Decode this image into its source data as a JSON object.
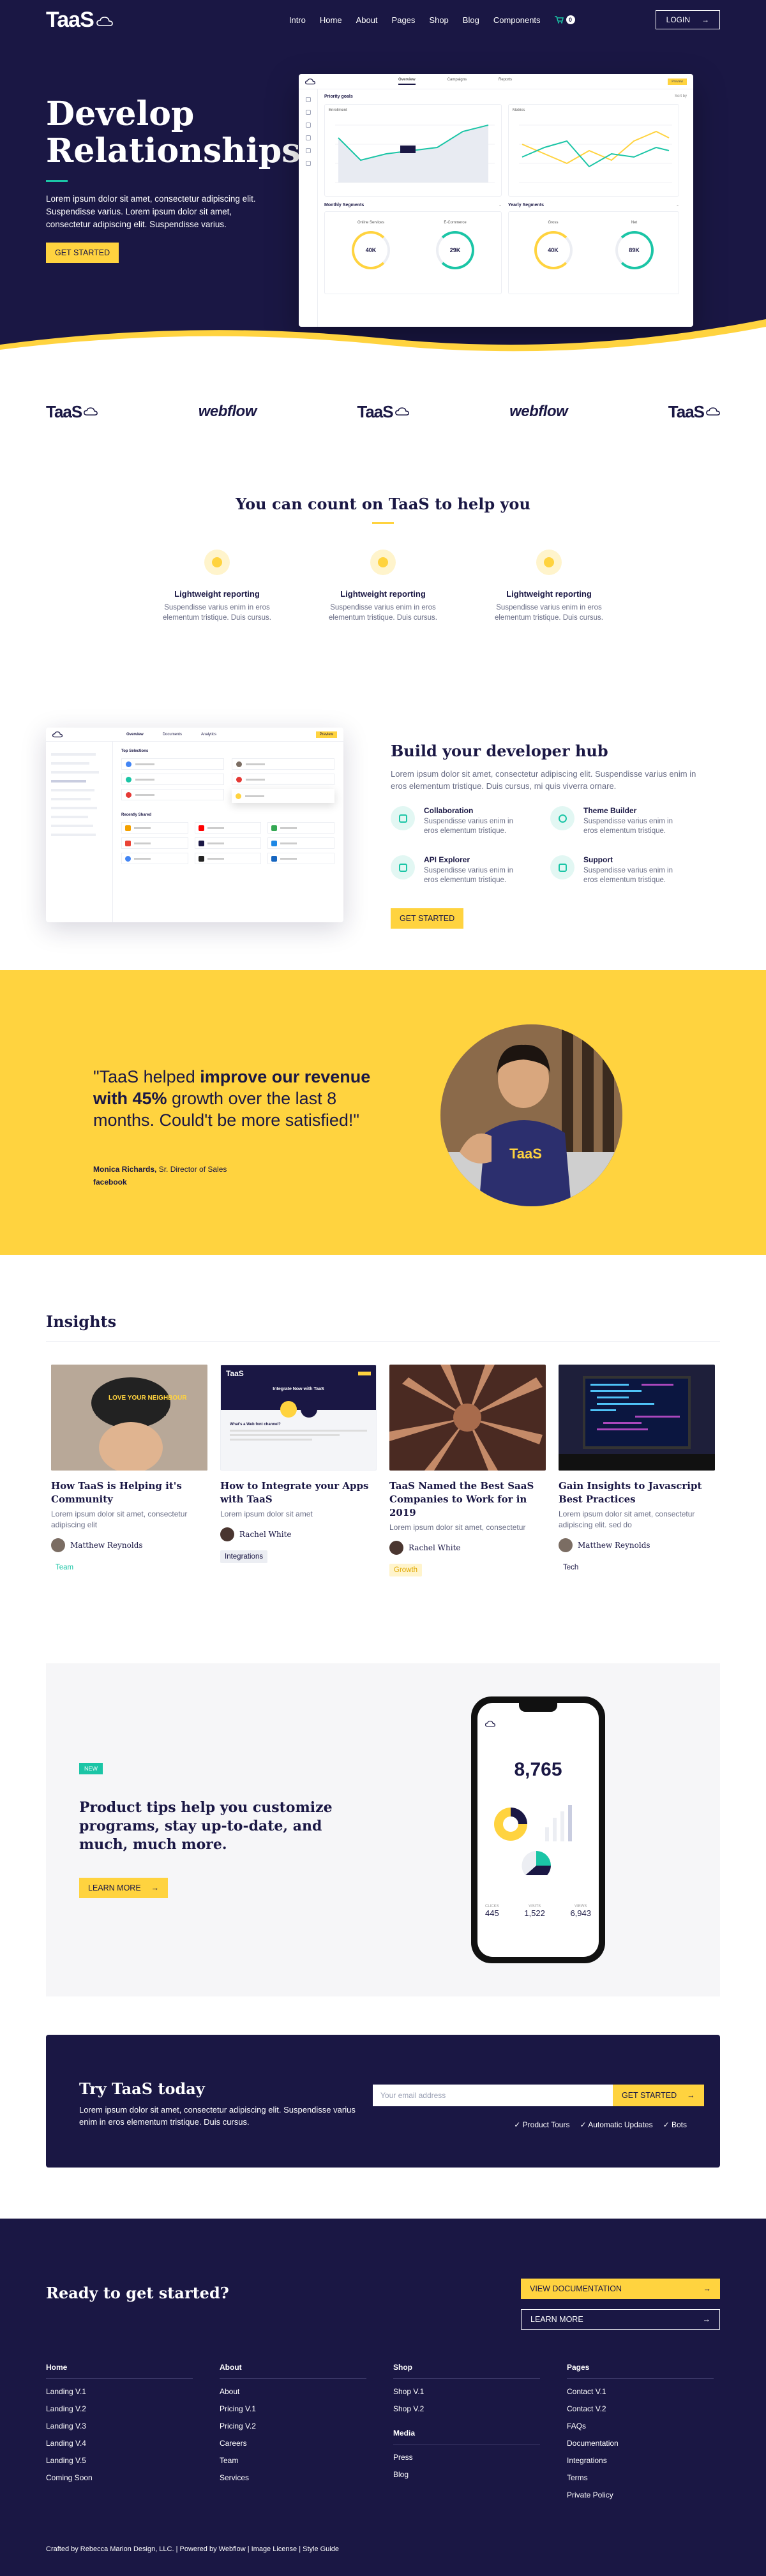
{
  "brand": "TaaS",
  "nav": {
    "links": [
      "Intro",
      "Home",
      "About",
      "Pages",
      "Shop",
      "Blog",
      "Components"
    ],
    "cart_count": "0",
    "login": "LOGIN"
  },
  "hero": {
    "title_line1": "Develop",
    "title_line2": "Relationships",
    "text": "Lorem ipsum dolor sit amet, consectetur adipiscing elit. Suspendisse varius. Lorem ipsum dolor sit amet, consectetur adipiscing elit. Suspendisse varius.",
    "cta": "GET STARTED",
    "dashboard": {
      "tabs": [
        "Overview",
        "Campaigns",
        "Reports"
      ],
      "badge": "Preview",
      "priority": "Priority goals",
      "priority_sub": "Sort by",
      "chart1_title": "Enrollment",
      "chart2_title": "Metrics",
      "monthly": "Monthly Segments",
      "yearly": "Yearly Segments",
      "m1": "Online Services",
      "m2": "E-Commerce",
      "y1": "Gross",
      "y2": "Net",
      "g1": "40K",
      "g2": "29K",
      "g3": "40K",
      "g4": "89K"
    }
  },
  "logos": [
    "TaaS",
    "webflow",
    "TaaS",
    "webflow",
    "TaaS"
  ],
  "count": {
    "title": "You can count on TaaS to help you",
    "features": [
      {
        "title": "Lightweight reporting",
        "text": "Suspendisse varius enim in eros elementum tristique. Duis cursus."
      },
      {
        "title": "Lightweight reporting",
        "text": "Suspendisse varius enim in eros elementum tristique. Duis cursus."
      },
      {
        "title": "Lightweight reporting",
        "text": "Suspendisse varius enim in eros elementum tristique. Duis cursus."
      }
    ]
  },
  "dev": {
    "title": "Build your developer hub",
    "text": "Lorem ipsum dolor sit amet, consectetur adipiscing elit. Suspendisse varius enim in eros elementum tristique. Duis cursus, mi quis viverra ornare.",
    "items": [
      {
        "title": "Collaboration",
        "text": "Suspendisse varius enim in eros elementum tristique."
      },
      {
        "title": "Theme Builder",
        "text": "Suspendisse varius enim in eros elementum tristique."
      },
      {
        "title": "API Explorer",
        "text": "Suspendisse varius enim in eros elementum tristique."
      },
      {
        "title": "Support",
        "text": "Suspendisse varius enim in eros elementum tristique."
      }
    ],
    "cta": "GET STARTED",
    "shot": {
      "tab1": "Overview",
      "tab2": "Documents",
      "tab3": "Analytics",
      "badge": "Preview",
      "top": "Top Selections",
      "recent": "Recently Shared"
    }
  },
  "testimonial": {
    "q1": "\"TaaS helped ",
    "q2": "improve our revenue with 45%",
    "q3": " growth over the last 8 months. Could't be more satisfied!\"",
    "name": "Monica Richards,",
    "role": " Sr. Director of Sales",
    "company": "facebook",
    "shirt": "TaaS"
  },
  "insights": {
    "title": "Insights",
    "cards": [
      {
        "title": "How TaaS is Helping it's Community",
        "text": "Lorem ipsum dolor sit amet, consectetur adipiscing elit",
        "author": "Matthew Reynolds",
        "tag": "Team",
        "tag_color": "#1bc5a6",
        "tag_bg": "#ffffff",
        "cap_text": "LOVE YOUR NEIGHBOUR"
      },
      {
        "title": "How to Integrate your Apps with TaaS",
        "text": "Lorem ipsum dolor sit amet",
        "author": "Rachel White",
        "tag": "Integrations",
        "tag_color": "#1a1744",
        "tag_bg": "#eceef3"
      },
      {
        "title": "TaaS Named the Best SaaS Companies to Work for in 2019",
        "text": "Lorem ipsum dolor sit amet, consectetur",
        "author": "Rachel White",
        "tag": "Growth",
        "tag_color": "#e0a800",
        "tag_bg": "#fff4cc"
      },
      {
        "title": "Gain Insights to Javascript Best Practices",
        "text": "Lorem ipsum dolor sit amet, consectetur adipiscing elit. sed do",
        "author": "Matthew Reynolds",
        "tag": "Tech",
        "tag_color": "#1a1744",
        "tag_bg": "#ffffff"
      }
    ],
    "mini": {
      "brand": "TaaS",
      "title": "Integrate Now with TaaS",
      "heading": "What's a Web font channel?"
    }
  },
  "tips": {
    "badge": "NEW",
    "title": "Product tips help you customize programs, stay up-to-date, and much, much more.",
    "cta": "LEARN MORE",
    "phone": {
      "big": "8,765",
      "s1": "445",
      "s2": "1,522",
      "s3": "6,943",
      "l1": "CLICKS",
      "l2": "VISITS",
      "l3": "VIEWS"
    }
  },
  "try": {
    "title": "Try TaaS today",
    "text": "Lorem ipsum dolor sit amet, consectetur adipiscing elit. Suspendisse varius enim in eros elementum tristique. Duis cursus.",
    "placeholder": "Your email address",
    "cta": "GET STARTED",
    "checks": [
      "Product Tours",
      "Automatic Updates",
      "Bots"
    ]
  },
  "footer": {
    "ready": "Ready to get started?",
    "docs": "VIEW DOCUMENTATION",
    "learn": "LEARN MORE",
    "home": {
      "title": "Home",
      "links": [
        "Landing V.1",
        "Landing V.2",
        "Landing V.3",
        "Landing V.4",
        "Landing V.5",
        "Coming Soon"
      ]
    },
    "about": {
      "title": "About",
      "links": [
        "About",
        "Pricing V.1",
        "Pricing V.2",
        "Careers",
        "Team",
        "Services"
      ]
    },
    "shop": {
      "title": "Shop",
      "links": [
        "Shop V.1",
        "Shop V.2"
      ]
    },
    "media": {
      "title": "Media",
      "links": [
        "Press",
        "Blog"
      ]
    },
    "pages": {
      "title": "Pages",
      "links": [
        "Contact V.1",
        "Contact V.2",
        "FAQs",
        "Documentation",
        "Integrations",
        "Terms",
        "Private Policy"
      ]
    },
    "credits": "Crafted by Rebecca Marion Design, LLC. | Powered by Webflow | Image License | Style Guide"
  },
  "colors": {
    "navy": "#1a1744",
    "yellow": "#ffd33f",
    "teal": "#1bc5a6"
  }
}
